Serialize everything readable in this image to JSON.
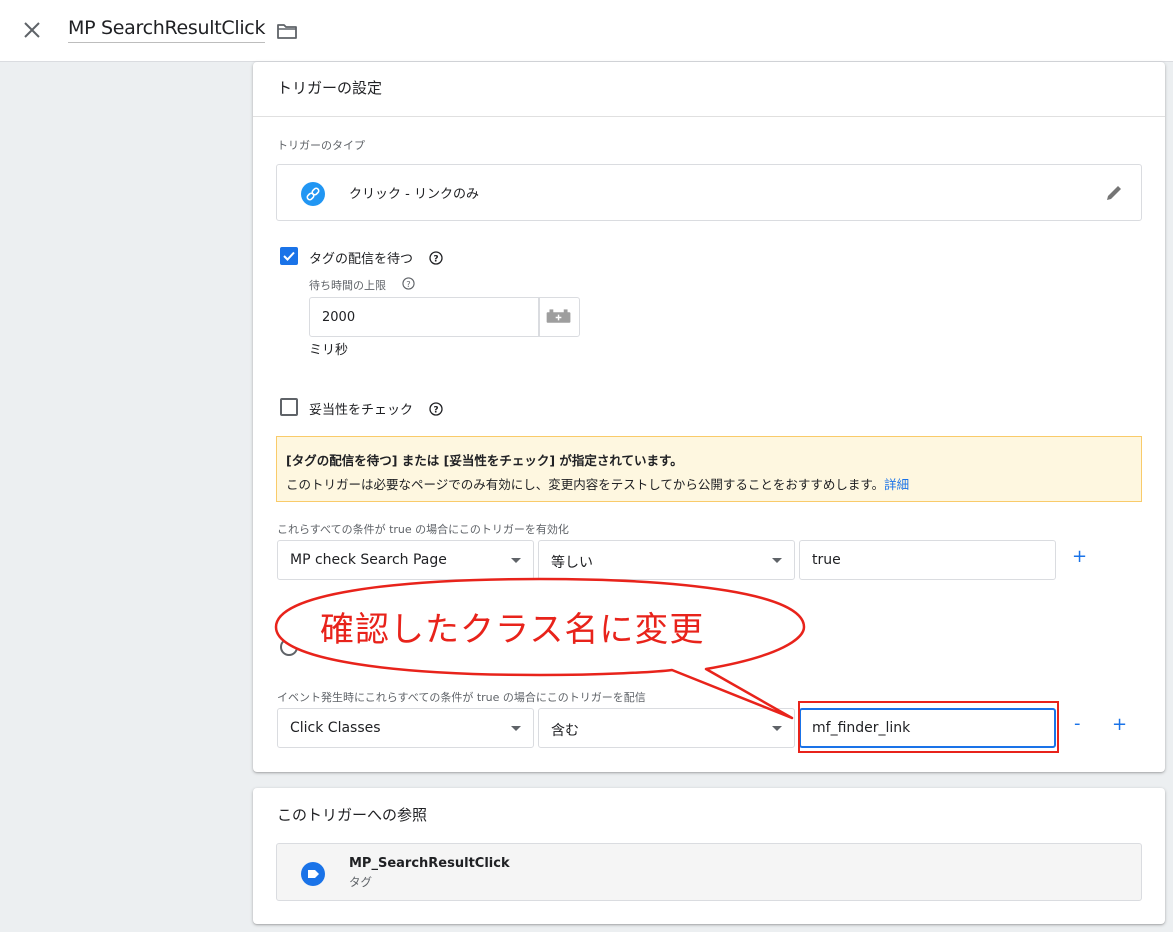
{
  "header": {
    "title": "MP SearchResultClick"
  },
  "trigger_config": {
    "section_title": "トリガーの設定",
    "type_label": "トリガーのタイプ",
    "type_value": "クリック - リンクのみ",
    "wait_for_tags": {
      "label": "タグの配信を待つ",
      "checked": true,
      "max_wait_label": "待ち時間の上限",
      "max_wait_value": "2000",
      "unit": "ミリ秒"
    },
    "check_validation": {
      "label": "妥当性をチェック",
      "checked": false
    },
    "warning": {
      "title": "[タグの配信を待つ] または [妥当性をチェック] が指定されています。",
      "body": "このトリガーは必要なページでのみ有効にし、変更内容をテストしてから公開することをおすすめします。",
      "link": "詳細"
    },
    "enable_conditions": {
      "label": "これらすべての条件が true の場合にこのトリガーを有効化",
      "variable": "MP check Search Page",
      "operator": "等しい",
      "value": "true",
      "add_label": "+"
    },
    "fire_conditions": {
      "label": "イベント発生時にこれらすべての条件が true の場合にこのトリガーを配信",
      "variable": "Click Classes",
      "operator": "含む",
      "value": "mf_finder_link",
      "remove_label": "-",
      "add_label": "+"
    }
  },
  "annotation": {
    "text": "確認したクラス名に変更",
    "color": "#e8231b"
  },
  "references": {
    "title": "このトリガーへの参照",
    "items": [
      {
        "name": "MP_SearchResultClick",
        "type": "タグ"
      }
    ]
  },
  "colors": {
    "accent": "#1a73e8",
    "link_icon": "#2196f3",
    "warning_bg": "#fef7e0"
  }
}
